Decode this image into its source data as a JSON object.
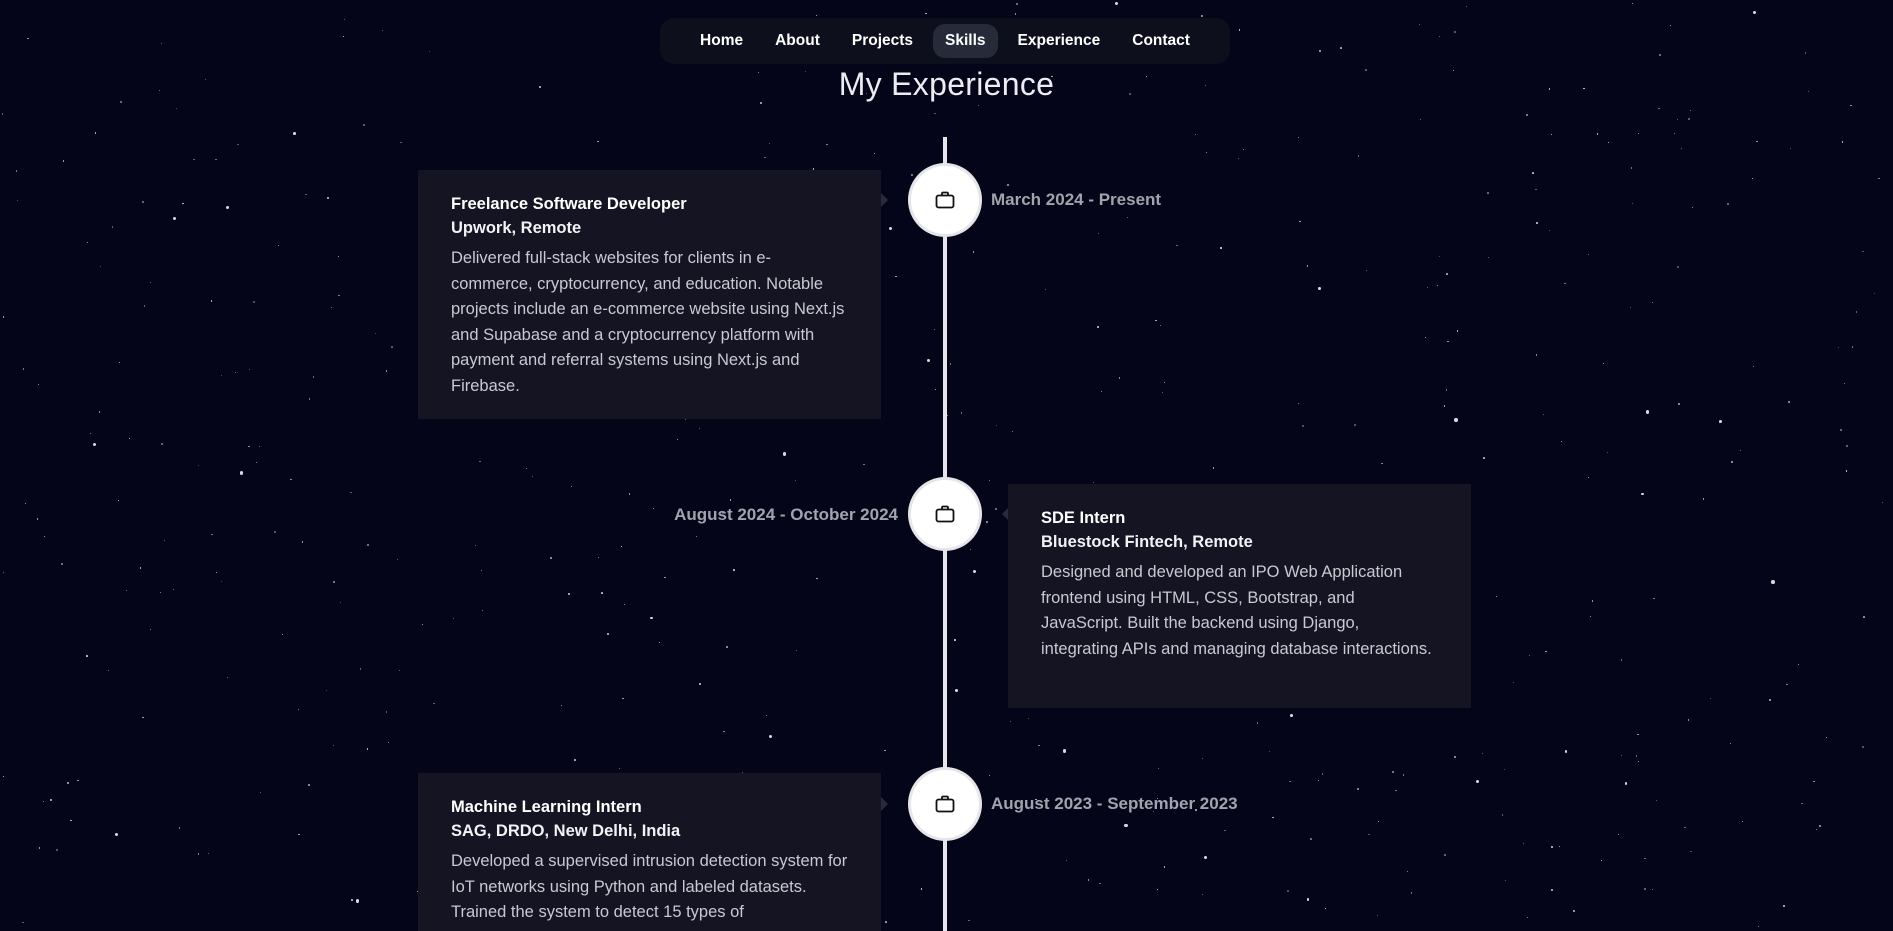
{
  "nav": {
    "items": [
      {
        "label": "Home",
        "active": false
      },
      {
        "label": "About",
        "active": false
      },
      {
        "label": "Projects",
        "active": false
      },
      {
        "label": "Skills",
        "active": true
      },
      {
        "label": "Experience",
        "active": false
      },
      {
        "label": "Contact",
        "active": false
      }
    ]
  },
  "page": {
    "title": "My Experience"
  },
  "timeline": {
    "icon": "briefcase-icon",
    "entries": [
      {
        "role": "Freelance Software Developer",
        "company": "Upwork, Remote",
        "date": "March 2024 - Present",
        "description": "Delivered full-stack websites for clients in e-commerce, cryptocurrency, and education. Notable projects include an e-commerce website using Next.js and Supabase and a cryptocurrency platform with payment and referral systems using Next.js and Firebase."
      },
      {
        "role": "SDE Intern",
        "company": "Bluestock Fintech, Remote",
        "date": "August 2024 - October 2024",
        "description": "Designed and developed an IPO Web Application frontend using HTML, CSS, Bootstrap, and JavaScript. Built the backend using Django, integrating APIs and managing database interactions."
      },
      {
        "role": "Machine Learning Intern",
        "company": "SAG, DRDO, New Delhi, India",
        "date": "August 2023 - September 2023",
        "description": "Developed a supervised intrusion detection system for IoT networks using Python and labeled datasets. Trained the system to detect 15 types of"
      }
    ]
  },
  "colors": {
    "background": "#05051a",
    "card": "#141423",
    "nav_active": "#262b3a",
    "timeline": "#e6e6ea",
    "date_text": "#a3a3ad"
  }
}
